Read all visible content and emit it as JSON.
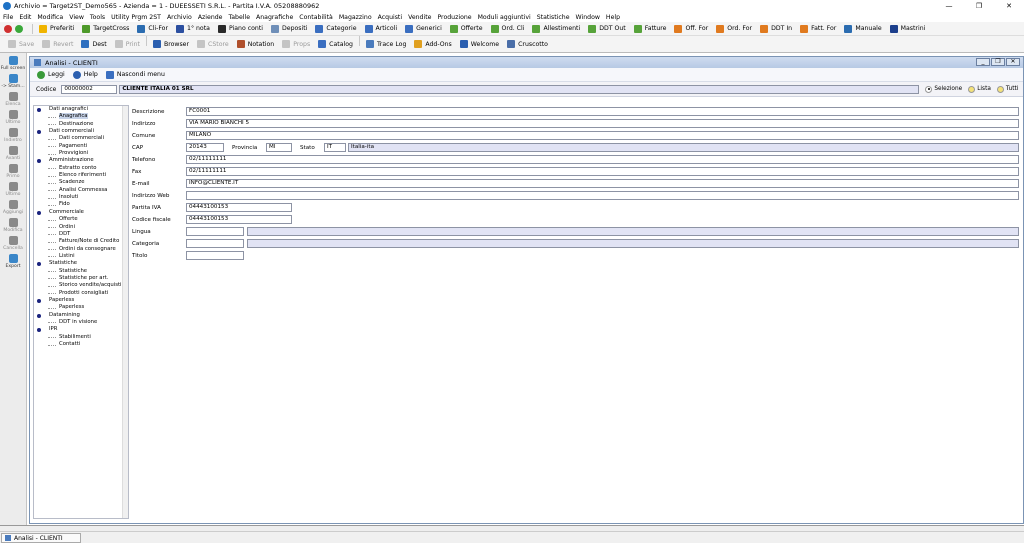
{
  "titlebar": {
    "title": "Archivio = Target2ST_Demo565 - Azienda = 1 - DUEESSETI S.R.L. - Partita I.V.A. 05208880962",
    "controls": [
      "—",
      "❐",
      "✕"
    ]
  },
  "menubar": {
    "items": [
      "File",
      "Edit",
      "Modifica",
      "View",
      "Tools",
      "Utility Prgm 2ST",
      "Archivio",
      "Aziende",
      "Tabelle",
      "Anagrafiche",
      "Contabilità",
      "Magazzino",
      "Acquisti",
      "Vendite",
      "Produzione",
      "Moduli aggiuntivi",
      "Statistiche",
      "Window",
      "Help"
    ]
  },
  "toolbar1": {
    "items": [
      {
        "label": "Preferiti",
        "icon": "star-icon",
        "color": "#f0b400"
      },
      {
        "label": "TargetCross",
        "icon": "grid-icon",
        "color": "#4e9a2a"
      },
      {
        "label": "Cli-For",
        "icon": "user-icon",
        "color": "#2b6cb0"
      },
      {
        "label": "1° nota",
        "icon": "note-icon",
        "color": "#2b4fa0"
      },
      {
        "label": "Piano conti",
        "icon": "ledger-icon",
        "color": "#2a2a2a"
      },
      {
        "label": "Depositi",
        "icon": "warehouse-icon",
        "color": "#6f8fb8"
      },
      {
        "label": "Categorie",
        "icon": "category-icon",
        "color": "#3a6ec0"
      },
      {
        "label": "Articoli",
        "icon": "box-icon",
        "color": "#3a6ec0"
      },
      {
        "label": "Generici",
        "icon": "generic-icon",
        "color": "#3a6ec0"
      },
      {
        "label": "Offerte",
        "icon": "offer-icon",
        "color": "#57a33a"
      },
      {
        "label": "Ord. Cli",
        "icon": "order-icon",
        "color": "#57a33a"
      },
      {
        "label": "Allestimenti",
        "icon": "setup-icon",
        "color": "#57a33a"
      },
      {
        "label": "DDT Out",
        "icon": "ddt-out-icon",
        "color": "#57a33a"
      },
      {
        "label": "Fatture",
        "icon": "invoice-icon",
        "color": "#57a33a"
      },
      {
        "label": "Off. For",
        "icon": "offer-supplier-icon",
        "color": "#e07a1f"
      },
      {
        "label": "Ord. For",
        "icon": "order-supplier-icon",
        "color": "#e07a1f"
      },
      {
        "label": "DDT In",
        "icon": "ddt-in-icon",
        "color": "#e07a1f"
      },
      {
        "label": "Fatt. For",
        "icon": "invoice-supplier-icon",
        "color": "#e07a1f"
      },
      {
        "label": "Manuale",
        "icon": "help-icon",
        "color": "#2b6cb0"
      },
      {
        "label": "Mastrini",
        "icon": "ledger-book-icon",
        "color": "#1c3f8c"
      }
    ]
  },
  "toolbar2": {
    "items": [
      {
        "label": "Save",
        "icon": "save-icon",
        "disabled": true
      },
      {
        "label": "Revert",
        "icon": "revert-icon",
        "disabled": true
      },
      {
        "label": "Dest",
        "icon": "destination-icon",
        "disabled": false
      },
      {
        "label": "Print",
        "icon": "print-icon",
        "disabled": true
      },
      {
        "label": "Browser",
        "icon": "browser-icon",
        "disabled": false
      },
      {
        "label": "CStore",
        "icon": "store-icon",
        "disabled": true
      },
      {
        "label": "Notation",
        "icon": "notation-icon",
        "disabled": false
      },
      {
        "label": "Props",
        "icon": "props-icon",
        "disabled": true
      },
      {
        "label": "Catalog",
        "icon": "catalog-icon",
        "disabled": false
      },
      {
        "label": "Trace Log",
        "icon": "trace-log-icon",
        "disabled": false
      },
      {
        "label": "Add-Ons",
        "icon": "addons-icon",
        "disabled": false
      },
      {
        "label": "Welcome",
        "icon": "welcome-icon",
        "disabled": false
      },
      {
        "label": "Cruscotto",
        "icon": "dashboard-icon",
        "disabled": false
      }
    ]
  },
  "leftbar": {
    "items": [
      {
        "label": "Full screen",
        "active": true
      },
      {
        "label": "-> Stam...",
        "active": true
      },
      {
        "label": "Elenca",
        "active": false
      },
      {
        "label": "Ultimo",
        "active": false
      },
      {
        "label": "Indietro",
        "active": false
      },
      {
        "label": "Avanti",
        "active": false
      },
      {
        "label": "Primo",
        "active": false
      },
      {
        "label": "Ultimo",
        "active": false
      },
      {
        "label": "Aggiungi",
        "active": false
      },
      {
        "label": "Modifica",
        "active": false
      },
      {
        "label": "Cancella",
        "active": false
      },
      {
        "label": "Export",
        "active": true
      }
    ]
  },
  "window": {
    "title": "Analisi - CLIENTI",
    "toolbar": [
      "Leggi",
      "Help",
      "Nascondi menu"
    ]
  },
  "codice": {
    "label": "Codice",
    "value": "00000002",
    "name": "CLIENTE ITALIA 01 SRL"
  },
  "radio": {
    "options": [
      {
        "label": "Selezione",
        "selected": true
      },
      {
        "label": "Lista",
        "selected": false
      },
      {
        "label": "Tutti",
        "selected": false
      }
    ]
  },
  "tree": [
    {
      "label": "Dati anagrafici",
      "type": "group"
    },
    {
      "label": "Anagrafica",
      "type": "item",
      "selected": true
    },
    {
      "label": "Destinazione",
      "type": "item"
    },
    {
      "label": "Dati commerciali",
      "type": "group"
    },
    {
      "label": "Dati commerciali",
      "type": "item"
    },
    {
      "label": "Pagamenti",
      "type": "item"
    },
    {
      "label": "Provvigioni",
      "type": "item"
    },
    {
      "label": "Amministrazione",
      "type": "group"
    },
    {
      "label": "Estratto conto",
      "type": "item"
    },
    {
      "label": "Elenco riferimenti",
      "type": "item"
    },
    {
      "label": "Scadenze",
      "type": "item"
    },
    {
      "label": "Analisi Commessa",
      "type": "item"
    },
    {
      "label": "Insoluti",
      "type": "item"
    },
    {
      "label": "Fido",
      "type": "item"
    },
    {
      "label": "Commerciale",
      "type": "group"
    },
    {
      "label": "Offerte",
      "type": "item"
    },
    {
      "label": "Ordini",
      "type": "item"
    },
    {
      "label": "DDT",
      "type": "item"
    },
    {
      "label": "Fatture/Note di Credito",
      "type": "item"
    },
    {
      "label": "Ordini da consegnare",
      "type": "item"
    },
    {
      "label": "Listini",
      "type": "item"
    },
    {
      "label": "Statistiche",
      "type": "group"
    },
    {
      "label": "Statistiche",
      "type": "item"
    },
    {
      "label": "Statistiche per art.",
      "type": "item"
    },
    {
      "label": "Storico vendite/acquisti",
      "type": "item"
    },
    {
      "label": "Prodotti consigliati",
      "type": "item"
    },
    {
      "label": "Paperless",
      "type": "group"
    },
    {
      "label": "Paperless",
      "type": "item"
    },
    {
      "label": "Datamining",
      "type": "group"
    },
    {
      "label": "DDT in visione",
      "type": "item"
    },
    {
      "label": "IPR",
      "type": "group"
    },
    {
      "label": "Stabilimenti",
      "type": "item"
    },
    {
      "label": "Contatti",
      "type": "item"
    }
  ],
  "form": {
    "descrizione": {
      "label": "Descrizione",
      "value": "FC0001"
    },
    "indirizzo": {
      "label": "Indirizzo",
      "value": "VIA MARIO BIANCHI 5"
    },
    "comune": {
      "label": "Comune",
      "value": "MILANO"
    },
    "cap": {
      "label": "CAP",
      "value": "20143"
    },
    "provincia": {
      "label": "Provincia",
      "value": "MI"
    },
    "stato": {
      "label": "Stato",
      "value": "IT",
      "desc": "Italia-ita"
    },
    "telefono": {
      "label": "Telefono",
      "value": "02/11111111"
    },
    "fax": {
      "label": "Fax",
      "value": "02/11111111"
    },
    "email": {
      "label": "E-mail",
      "value": "INFO@CLIENTE.IT"
    },
    "web": {
      "label": "Indirizzo Web",
      "value": ""
    },
    "piva": {
      "label": "Partita IVA",
      "value": "04443100153"
    },
    "cf": {
      "label": "Codice fiscale",
      "value": "04443100153"
    },
    "lingua": {
      "label": "Lingua",
      "value": ""
    },
    "categoria": {
      "label": "Categoria",
      "value": ""
    },
    "titolo": {
      "label": "Titolo",
      "value": ""
    }
  },
  "taskbar": {
    "task": "Analisi - CLIENTI"
  }
}
